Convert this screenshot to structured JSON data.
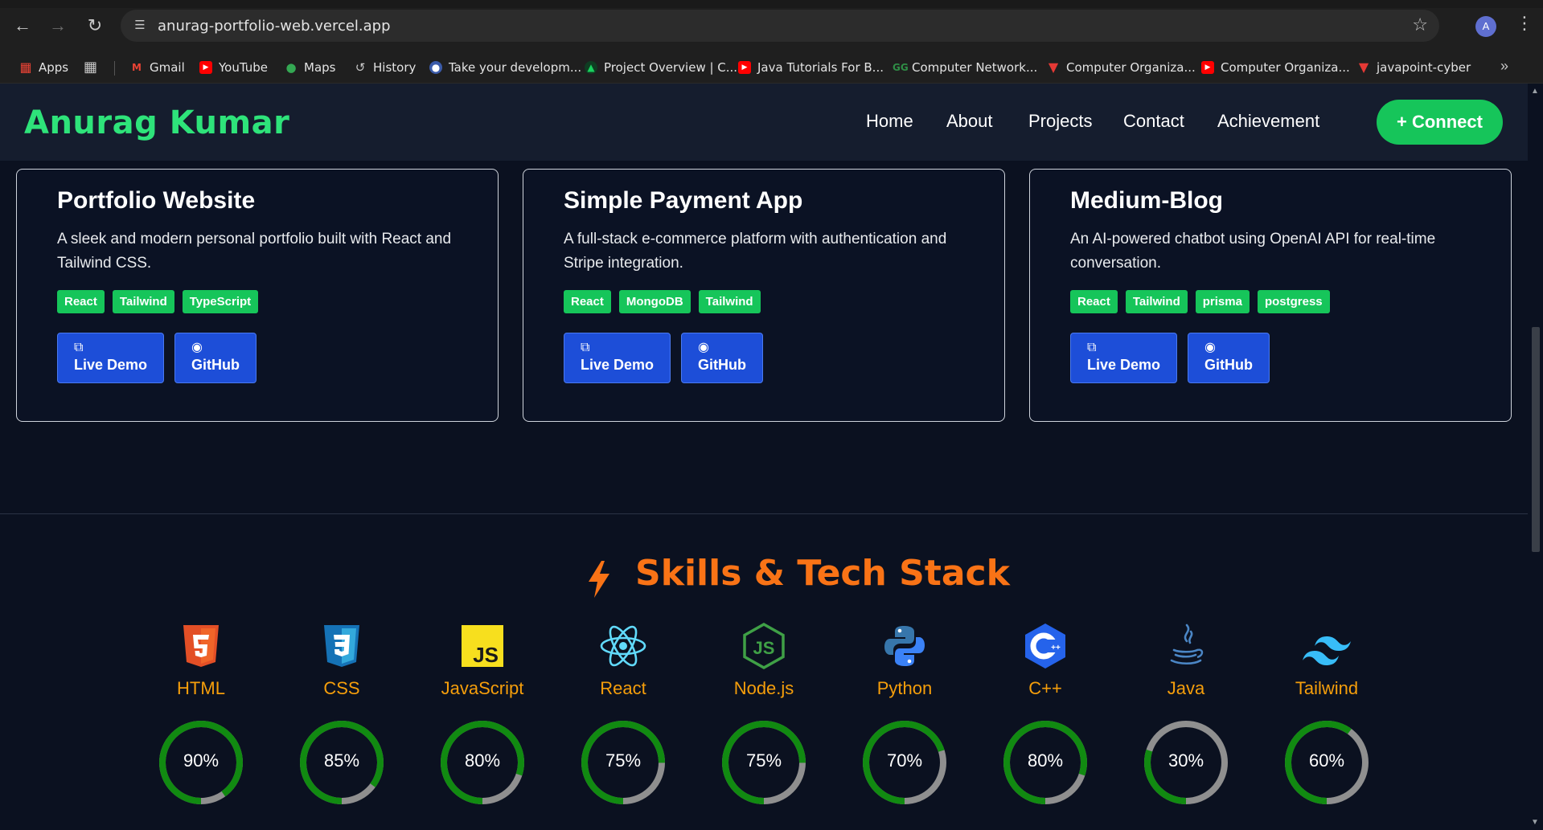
{
  "browser": {
    "url": "anurag-portfolio-web.vercel.app",
    "profile_initial": "A",
    "bookmarks": [
      {
        "label": "Apps",
        "icon": "apps-grid-icon",
        "color": "#ea4335"
      },
      {
        "label": "Gmail",
        "icon": "gmail-icon",
        "color": "#ea4335"
      },
      {
        "label": "YouTube",
        "icon": "youtube-icon",
        "color": "#ff0000"
      },
      {
        "label": "Maps",
        "icon": "maps-pin-icon",
        "color": "#34a853"
      },
      {
        "label": "History",
        "icon": "history-icon",
        "color": "#9aa0a6"
      },
      {
        "label": "Take your developm...",
        "icon": "avatar-icon",
        "color": "#4285f4"
      },
      {
        "label": "Project Overview | C...",
        "icon": "leaf-icon",
        "color": "#1a9f4b"
      },
      {
        "label": "Java Tutorials For B...",
        "icon": "youtube-icon",
        "color": "#ff0000"
      },
      {
        "label": "Computer Network...",
        "icon": "gfg-icon",
        "color": "#2f8d46"
      },
      {
        "label": "Computer Organiza...",
        "icon": "javatpoint-icon",
        "color": "#e53935"
      },
      {
        "label": "Computer Organiza...",
        "icon": "youtube-icon",
        "color": "#ff0000"
      },
      {
        "label": "javapoint-cyber",
        "icon": "javatpoint-icon",
        "color": "#e53935"
      }
    ]
  },
  "header": {
    "brand": "Anurag Kumar",
    "nav": [
      "Home",
      "About",
      "Projects",
      "Contact",
      "Achievement"
    ],
    "connect_label": "+ Connect"
  },
  "projects": [
    {
      "title": "Portfolio Website",
      "description": "A sleek and modern personal portfolio built with React and Tailwind CSS.",
      "tags": [
        "React",
        "Tailwind",
        "TypeScript"
      ],
      "demo_label": "Live Demo",
      "github_label": "GitHub"
    },
    {
      "title": "Simple Payment App",
      "description": "A full-stack e-commerce platform with authentication and Stripe integration.",
      "tags": [
        "React",
        "MongoDB",
        "Tailwind"
      ],
      "demo_label": "Live Demo",
      "github_label": "GitHub"
    },
    {
      "title": "Medium-Blog",
      "description": "An AI-powered chatbot using OpenAI API for real-time conversation.",
      "tags": [
        "React",
        "Tailwind",
        "prisma",
        "postgress"
      ],
      "demo_label": "Live Demo",
      "github_label": "GitHub"
    }
  ],
  "skills": {
    "title": "Skills & Tech Stack",
    "items": [
      {
        "name": "HTML",
        "percent": 90,
        "label": "90%",
        "icon": "html5-icon",
        "color": "#e34f26"
      },
      {
        "name": "CSS",
        "percent": 85,
        "label": "85%",
        "icon": "css3-icon",
        "color": "#1572b6"
      },
      {
        "name": "JavaScript",
        "percent": 80,
        "label": "80%",
        "icon": "javascript-icon",
        "color": "#f7df1e"
      },
      {
        "name": "React",
        "percent": 75,
        "label": "75%",
        "icon": "react-icon",
        "color": "#61dafb"
      },
      {
        "name": "Node.js",
        "percent": 75,
        "label": "75%",
        "icon": "nodejs-icon",
        "color": "#3c873a"
      },
      {
        "name": "Python",
        "percent": 70,
        "label": "70%",
        "icon": "python-icon",
        "color": "#3776ab"
      },
      {
        "name": "C++",
        "percent": 80,
        "label": "80%",
        "icon": "cplusplus-icon",
        "color": "#00599c"
      },
      {
        "name": "Java",
        "percent": 30,
        "label": "30%",
        "icon": "java-icon",
        "color": "#5382a1"
      },
      {
        "name": "Tailwind",
        "percent": 60,
        "label": "60%",
        "icon": "tailwind-icon",
        "color": "#38bdf8"
      }
    ],
    "ring_fill_color": "#118a11",
    "ring_track_color": "#8f8f8f"
  }
}
